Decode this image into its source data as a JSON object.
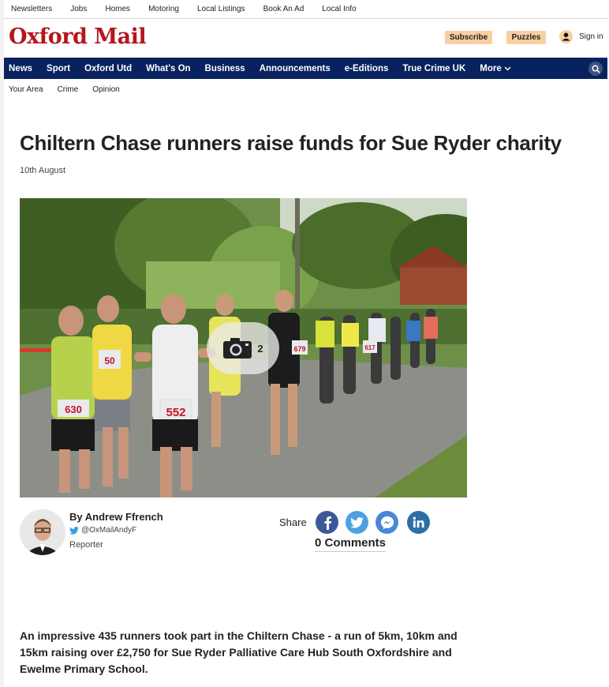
{
  "utility_nav": [
    "Newsletters",
    "Jobs",
    "Homes",
    "Motoring",
    "Local Listings",
    "Book An Ad",
    "Local Info"
  ],
  "masthead": {
    "logo": "Oxford Mail",
    "subscribe_label": "Subscribe",
    "puzzles_label": "Puzzles",
    "signin_label": "Sign in"
  },
  "main_nav": [
    "News",
    "Sport",
    "Oxford Utd",
    "What's On",
    "Business",
    "Announcements",
    "e-Editions",
    "True Crime UK"
  ],
  "more_label": "More",
  "sub_nav": [
    "Your Area",
    "Crime",
    "Opinion"
  ],
  "article": {
    "headline": "Chiltern Chase runners raise funds for Sue Ryder charity",
    "date": "10th August",
    "gallery_count": "2",
    "author_name": "By Andrew Ffrench",
    "author_handle": "@OxMailAndyF",
    "author_role": "Reporter",
    "share_label": "Share",
    "comments_label": "0 Comments",
    "lead": "An impressive 435 runners took part in the Chiltern Chase - a run of 5km, 10km and 15km raising over £2,750 for Sue Ryder Palliative Care Hub South Oxfordshire and Ewelme Primary School."
  },
  "photo": {
    "bib_numbers": [
      "630",
      "552",
      "50",
      "679",
      "617"
    ]
  },
  "colors": {
    "brand_red": "#b3171e",
    "nav_navy": "#07225e",
    "pill_peach": "#f8cfa0",
    "facebook": "#3b5998",
    "twitter": "#4da1e0",
    "messenger": "#4a86d8",
    "linkedin": "#2e6ea8"
  },
  "icons": [
    "user-icon",
    "search-icon",
    "chevron-down-icon",
    "camera-icon",
    "twitter-bird-icon",
    "facebook-icon",
    "twitter-icon",
    "messenger-icon",
    "linkedin-icon"
  ]
}
